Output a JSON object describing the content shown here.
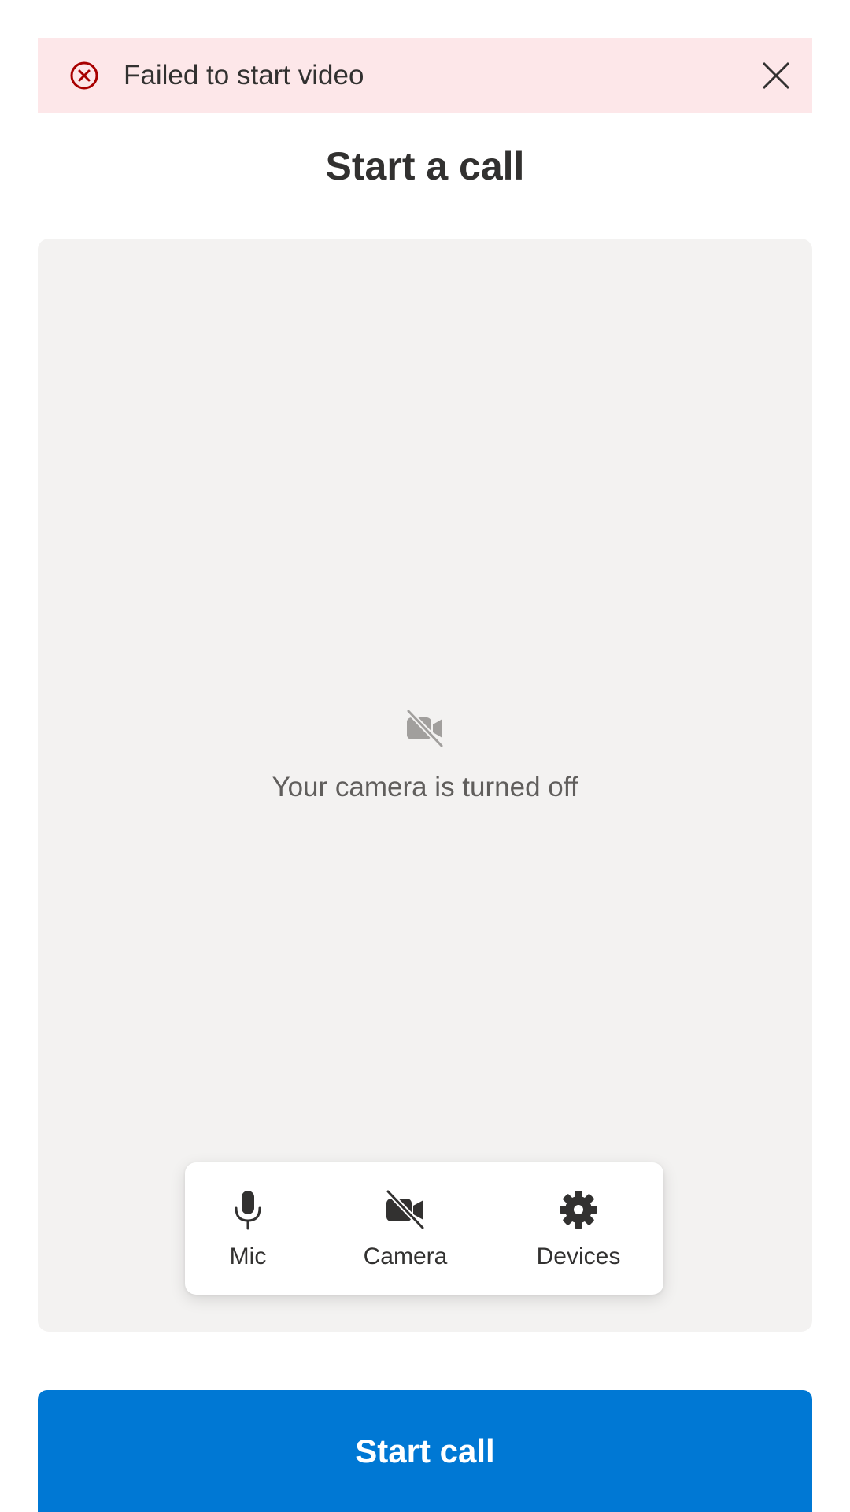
{
  "error_banner": {
    "message": "Failed to start video",
    "icon": "error-circle-icon",
    "close_icon": "close-icon",
    "background_color": "#fde7e9",
    "icon_color": "#a80000"
  },
  "title": "Start a call",
  "preview": {
    "camera_off_icon": "video-off-icon",
    "camera_off_text": "Your camera is turned off",
    "background_color": "#f3f2f1"
  },
  "controls": {
    "mic": {
      "label": "Mic",
      "icon": "microphone-icon"
    },
    "camera": {
      "label": "Camera",
      "icon": "video-off-icon"
    },
    "devices": {
      "label": "Devices",
      "icon": "gear-icon"
    }
  },
  "start_button": {
    "label": "Start call",
    "color": "#0078d4"
  }
}
